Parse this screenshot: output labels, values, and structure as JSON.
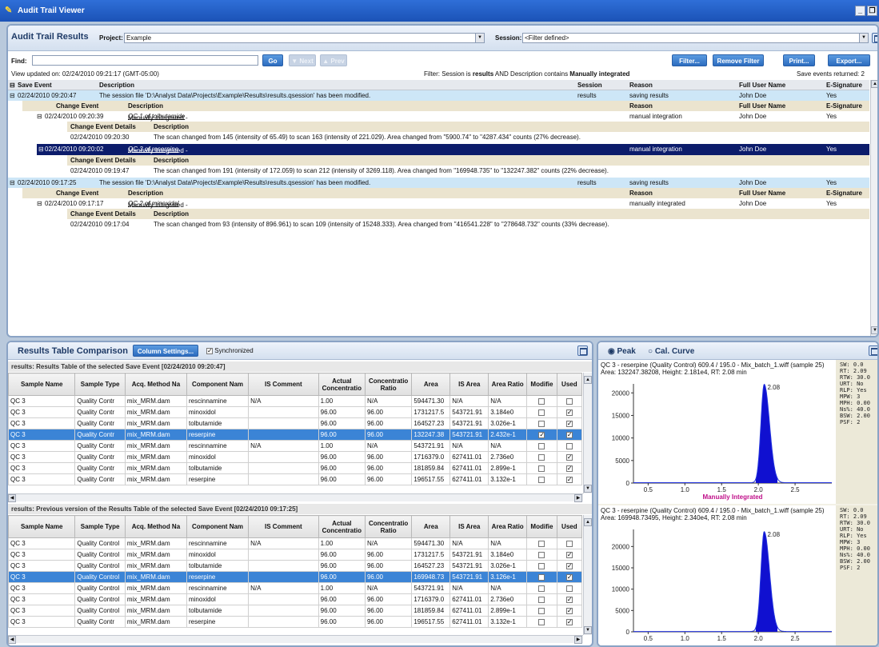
{
  "window": {
    "title": "Audit Trail Viewer"
  },
  "audit": {
    "title": "Audit Trail Results",
    "project_label": "Project:",
    "project_value": "Example",
    "session_label": "Session:",
    "session_value": "<Filter defined>",
    "find_label": "Find:",
    "go": "Go",
    "next": "Next",
    "prev": "Prev",
    "filter_btn": "Filter...",
    "remove_filter_btn": "Remove Filter",
    "print_btn": "Print...",
    "export_btn": "Export...",
    "view_updated": "View updated on: 02/24/2010 09:21:17 (GMT-05:00)",
    "filter_text_a": "Filter: Session is ",
    "filter_text_b": "results",
    "filter_text_c": " AND Description contains ",
    "filter_text_d": "Manually integrated",
    "events_returned": "Save events returned:  2",
    "cols": {
      "save_event": "Save Event",
      "description": "Description",
      "session": "Session",
      "reason": "Reason",
      "full_user": "Full User Name",
      "esig": "E-Signature"
    },
    "sub_cols": {
      "change_event": "Change Event",
      "description": "Description",
      "reason": "Reason",
      "full_user": "Full User Name",
      "esig": "E-Signature"
    },
    "detail_cols": {
      "details": "Change Event Details",
      "description": "Description"
    },
    "events": [
      {
        "time": "02/24/2010 09:20:47",
        "desc": "The session file 'D:\\Analyst Data\\Projects\\Example\\Results\\results.qsession' has been modified.",
        "session": "results",
        "reason": "saving results",
        "user": "John Doe",
        "esig": "Yes",
        "changes": [
          {
            "time": "02/24/2010 09:20:39",
            "desc": "Manually integrated - ",
            "link": "QC 1 of tolbutamide",
            "reason": "manual integration",
            "user": "John Doe",
            "esig": "Yes",
            "detail_time": "02/24/2010 09:20:30",
            "detail": "The scan changed from 145 (intensity of 65.49) to scan 163 (intensity of 221.029). Area changed from \"5900.74\" to \"4287.434\" counts (27% decrease)."
          },
          {
            "time": "02/24/2010 09:20:02",
            "desc": "Manually integrated - ",
            "link": "QC 3 of reserpine",
            "reason": "manual integration",
            "user": "John Doe",
            "esig": "Yes",
            "detail_time": "02/24/2010 09:19:47",
            "detail": "The scan changed from 191 (intensity of 172.059) to scan 212 (intensity of 3269.118). Area changed from \"169948.735\" to \"132247.382\" counts (22% decrease)."
          }
        ]
      },
      {
        "time": "02/24/2010 09:17:25",
        "desc": "The session file 'D:\\Analyst Data\\Projects\\Example\\Results\\results.qsession' has been modified.",
        "session": "results",
        "reason": "saving results",
        "user": "John Doe",
        "esig": "Yes",
        "changes": [
          {
            "time": "02/24/2010 09:17:17",
            "desc": "Manually integrated - ",
            "link": "QC 2 of minoxidol",
            "reason": "manually integrated",
            "user": "John Doe",
            "esig": "Yes",
            "detail_time": "02/24/2010 09:17:04",
            "detail": "The scan changed from 93 (intensity of 896.961) to scan 109 (intensity of 15248.333). Area changed from \"416541.228\" to \"278648.732\" counts (33% decrease)."
          }
        ]
      }
    ]
  },
  "compare": {
    "title": "Results Table Comparison",
    "column_settings": "Column Settings...",
    "synchronized": "Synchronized",
    "current_label": "results: Results Table of the selected Save Event  [02/24/2010 09:20:47]",
    "previous_label": "results: Previous version of the Results Table of the selected Save Event  [02/24/2010 09:17:25]",
    "columns": [
      "Sample Name",
      "Sample Type",
      "Acq. Method Na",
      "Component Nam",
      "IS Comment",
      "Actual Concentratio",
      "Concentratio Ratio",
      "Area",
      "IS Area",
      "Area Ratio",
      "Modifie",
      "Used"
    ],
    "current_rows": [
      [
        "QC 3",
        "Quality Contr",
        "mix_MRM.dam",
        "rescinnamine",
        "N/A",
        "1.00",
        "N/A",
        "594471.30",
        "N/A",
        "N/A",
        "0",
        "0"
      ],
      [
        "QC 3",
        "Quality Contr",
        "mix_MRM.dam",
        "minoxidol",
        "",
        "96.00",
        "96.00",
        "1731217.5",
        "543721.91",
        "3.184e0",
        "0",
        "1"
      ],
      [
        "QC 3",
        "Quality Contr",
        "mix_MRM.dam",
        "tolbutamide",
        "",
        "96.00",
        "96.00",
        "164527.23",
        "543721.91",
        "3.026e-1",
        "0",
        "1"
      ],
      [
        "QC 3",
        "Quality Contr",
        "mix_MRM.dam",
        "reserpine",
        "",
        "96.00",
        "96.00",
        "132247.38",
        "543721.91",
        "2.432e-1",
        "1",
        "1"
      ],
      [
        "QC 3",
        "Quality Contr",
        "mix_MRM.dam",
        "rescinnamine",
        "N/A",
        "1.00",
        "N/A",
        "543721.91",
        "N/A",
        "N/A",
        "0",
        "0"
      ],
      [
        "QC 3",
        "Quality Contr",
        "mix_MRM.dam",
        "minoxidol",
        "",
        "96.00",
        "96.00",
        "1716379.0",
        "627411.01",
        "2.736e0",
        "0",
        "1"
      ],
      [
        "QC 3",
        "Quality Contr",
        "mix_MRM.dam",
        "tolbutamide",
        "",
        "96.00",
        "96.00",
        "181859.84",
        "627411.01",
        "2.899e-1",
        "0",
        "1"
      ],
      [
        "QC 3",
        "Quality Contr",
        "mix_MRM.dam",
        "reserpine",
        "",
        "96.00",
        "96.00",
        "196517.55",
        "627411.01",
        "3.132e-1",
        "0",
        "1"
      ]
    ],
    "current_selected": 3,
    "previous_rows": [
      [
        "QC 3",
        "Quality Control",
        "mix_MRM.dam",
        "rescinnamine",
        "N/A",
        "1.00",
        "N/A",
        "594471.30",
        "N/A",
        "N/A",
        "0",
        "0"
      ],
      [
        "QC 3",
        "Quality Control",
        "mix_MRM.dam",
        "minoxidol",
        "",
        "96.00",
        "96.00",
        "1731217.5",
        "543721.91",
        "3.184e0",
        "0",
        "1"
      ],
      [
        "QC 3",
        "Quality Control",
        "mix_MRM.dam",
        "tolbutamide",
        "",
        "96.00",
        "96.00",
        "164527.23",
        "543721.91",
        "3.026e-1",
        "0",
        "1"
      ],
      [
        "QC 3",
        "Quality Control",
        "mix_MRM.dam",
        "reserpine",
        "",
        "96.00",
        "96.00",
        "169948.73",
        "543721.91",
        "3.126e-1",
        "0",
        "1"
      ],
      [
        "QC 3",
        "Quality Control",
        "mix_MRM.dam",
        "rescinnamine",
        "N/A",
        "1.00",
        "N/A",
        "543721.91",
        "N/A",
        "N/A",
        "0",
        "0"
      ],
      [
        "QC 3",
        "Quality Control",
        "mix_MRM.dam",
        "minoxidol",
        "",
        "96.00",
        "96.00",
        "1716379.0",
        "627411.01",
        "2.736e0",
        "0",
        "1"
      ],
      [
        "QC 3",
        "Quality Control",
        "mix_MRM.dam",
        "tolbutamide",
        "",
        "96.00",
        "96.00",
        "181859.84",
        "627411.01",
        "2.899e-1",
        "0",
        "1"
      ],
      [
        "QC 3",
        "Quality Contr",
        "mix_MRM.dam",
        "reserpine",
        "",
        "96.00",
        "96.00",
        "196517.55",
        "627411.01",
        "3.132e-1",
        "0",
        "1"
      ]
    ],
    "previous_selected": 3
  },
  "peak": {
    "peak_option": "Peak",
    "cal_option": "Cal. Curve",
    "top": {
      "caption1": "QC 3 - reserpine (Quality Control) 609.4 / 195.0 - Mix_batch_1.wiff (sample 25)",
      "caption2": "Area: 132247.38208, Height: 2.181e4, RT: 2.08 min",
      "stats": "SW: 0.0\nRT: 2.09\nRTW: 30.0\nURT: No\nRLP: Yes\nMPW: 3\nMPH: 0.00\nNs%: 40.0\nBSW: 2.00\nPSF: 2",
      "flag": "Manually Integrated",
      "peak_label": "2.08"
    },
    "bottom": {
      "caption1": "QC 3 - reserpine (Quality Control) 609.4 / 195.0 - Mix_batch_1.wiff (sample 25)",
      "caption2": "Area: 169948.73495, Height: 2.340e4, RT: 2.08 min",
      "stats": "SW: 0.0\nRT: 2.09\nRTW: 30.0\nURT: No\nRLP: Yes\nMPW: 3\nMPH: 0.00\nNs%: 40.0\nBSW: 2.00\nPSF: 2",
      "peak_label": "2.08"
    },
    "chart_data": [
      {
        "type": "line",
        "x_ticks": [
          "0.5",
          "1.0",
          "1.5",
          "2.0",
          "2.5"
        ],
        "y_ticks": [
          "0",
          "5000",
          "10000",
          "15000",
          "20000"
        ],
        "xlim": [
          0.3,
          3.0
        ],
        "ylim": [
          0,
          22000
        ],
        "peak_rt": 2.08,
        "peak_height": 21810,
        "fill_color": "#1010d0"
      },
      {
        "type": "line",
        "x_ticks": [
          "0.5",
          "1.0",
          "1.5",
          "2.0",
          "2.5"
        ],
        "y_ticks": [
          "0",
          "5000",
          "10000",
          "15000",
          "20000"
        ],
        "xlim": [
          0.3,
          3.0
        ],
        "ylim": [
          0,
          24000
        ],
        "peak_rt": 2.08,
        "peak_height": 23400,
        "fill_color": "#1010d0"
      }
    ]
  }
}
